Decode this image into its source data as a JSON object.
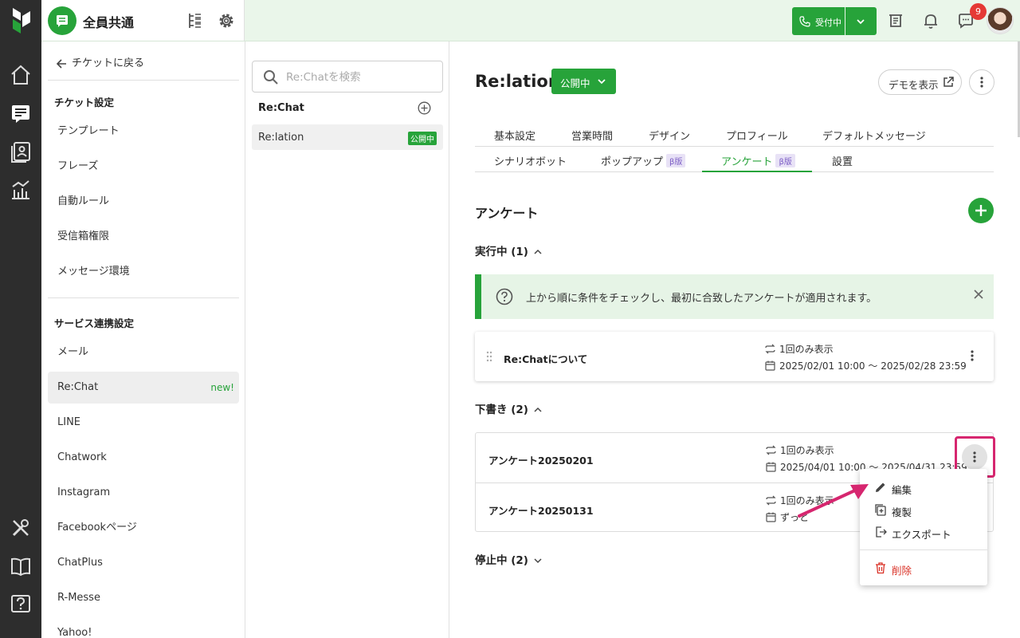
{
  "topbar": {
    "workspace_title": "全員共通",
    "call_status_label": "受付中",
    "notification_count": "9"
  },
  "settings_nav": {
    "back_label": "チケットに戻る",
    "ticket_section_title": "チケット設定",
    "ticket_items": [
      "テンプレート",
      "フレーズ",
      "自動ルール",
      "受信箱権限",
      "メッセージ環境"
    ],
    "integration_section_title": "サービス連携設定",
    "integration_items": [
      "メール",
      "Re:Chat",
      "LINE",
      "Chatwork",
      "Instagram",
      "Facebookページ",
      "ChatPlus",
      "R-Messe",
      "Yahoo!"
    ],
    "active_item": "Re:Chat",
    "new_badge": "new!"
  },
  "channel_list": {
    "search_placeholder": "Re:Chatを検索",
    "header": "Re:Chat",
    "items": [
      {
        "name": "Re:lation",
        "status": "公開中"
      }
    ]
  },
  "main": {
    "title": "Re:lation",
    "status_label": "公開中",
    "demo_button_label": "デモを表示",
    "tabs_row1": [
      "基本設定",
      "営業時間",
      "デザイン",
      "プロフィール",
      "デフォルトメッセージ"
    ],
    "tabs_row2": [
      "シナリオボット",
      "ポップアップ",
      "アンケート",
      "設置"
    ],
    "beta_label": "β版",
    "active_tab": "アンケート",
    "section_title": "アンケート",
    "running_group": "実行中 (1)",
    "info_text": "上から順に条件をチェックし、最初に合致したアンケートが適用されます。",
    "running_surveys": [
      {
        "name": "Re:Chatについて",
        "display": "1回のみ表示",
        "period": "2025/02/01 10:00 〜 2025/02/28 23:59"
      }
    ],
    "draft_group": "下書き (2)",
    "draft_surveys": [
      {
        "name": "アンケート20250201",
        "display": "1回のみ表示",
        "period": "2025/04/01 10:00 〜 2025/04/31 23:59"
      },
      {
        "name": "アンケート20250131",
        "display": "1回のみ表示",
        "period": "ずっと"
      }
    ],
    "stopped_group": "停止中 (2)"
  },
  "context_menu": {
    "edit": "編集",
    "duplicate": "複製",
    "export": "エクスポート",
    "delete": "削除"
  },
  "colors": {
    "brand_green": "#27a33a",
    "rail_dark": "#2d2d2d",
    "highlight_pink": "#d6266f",
    "danger_red": "#d93025",
    "beta_purple": "#7a5bc4"
  }
}
